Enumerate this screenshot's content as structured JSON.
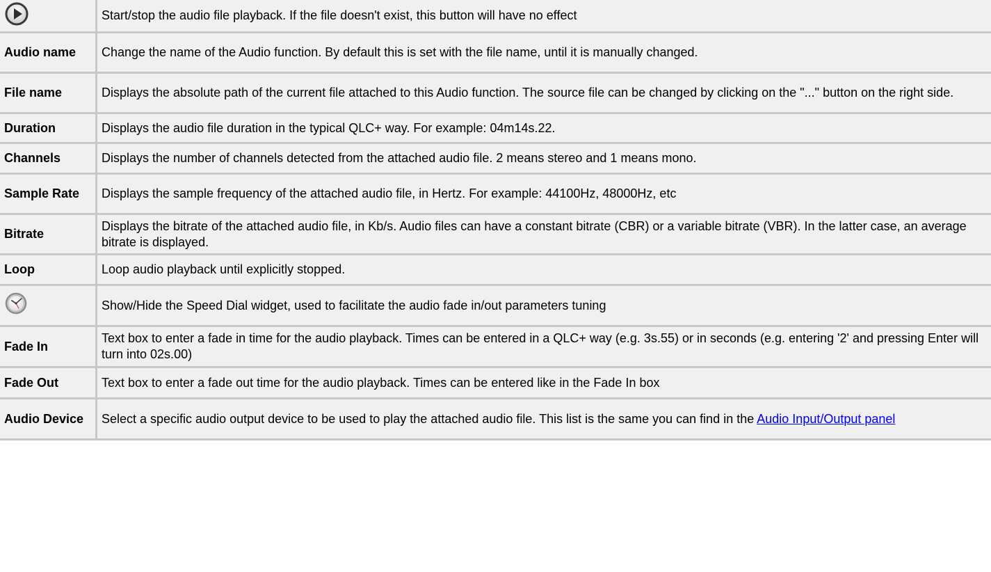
{
  "rows": [
    {
      "icon": "play-icon",
      "description": "Start/stop the audio file playback. If the file doesn't exist, this button will have no effect"
    },
    {
      "label": "Audio name",
      "description": "Change the name of the Audio function. By default this is set with the file name, until it is manually changed."
    },
    {
      "label": "File name",
      "description": "Displays the absolute path of the current file attached to this Audio function. The source file can be changed by clicking on the \"...\" button on the right side."
    },
    {
      "label": "Duration",
      "description": "Displays the audio file duration in the typical QLC+ way. For example: 04m14s.22."
    },
    {
      "label": "Channels",
      "description": "Displays the number of channels detected from the attached audio file. 2 means stereo and 1 means mono."
    },
    {
      "label": "Sample Rate",
      "description": "Displays the sample frequency of the attached audio file, in Hertz. For example: 44100Hz, 48000Hz, etc"
    },
    {
      "label": "Bitrate",
      "description": "Displays the bitrate of the attached audio file, in Kb/s. Audio files can have a constant bitrate (CBR) or a variable bitrate (VBR). In the latter case, an average bitrate is displayed."
    },
    {
      "label": "Loop",
      "description": "Loop audio playback until explicitly stopped."
    },
    {
      "icon": "clock-icon",
      "description": "Show/Hide the Speed Dial widget, used to facilitate the audio fade in/out parameters tuning"
    },
    {
      "label": "Fade In",
      "description": "Text box to enter a fade in time for the audio playback. Times can be entered in a QLC+ way (e.g. 3s.55) or in seconds (e.g. entering '2' and pressing Enter will turn into 02s.00)"
    },
    {
      "label": "Fade Out",
      "description": "Text box to enter a fade out time for the audio playback. Times can be entered like in the Fade In box"
    },
    {
      "label": "Audio Device",
      "description": "Select a specific audio output device to be used to play the attached audio file. This list is the same you can find in the",
      "link_text": "Audio Input/Output panel"
    }
  ]
}
